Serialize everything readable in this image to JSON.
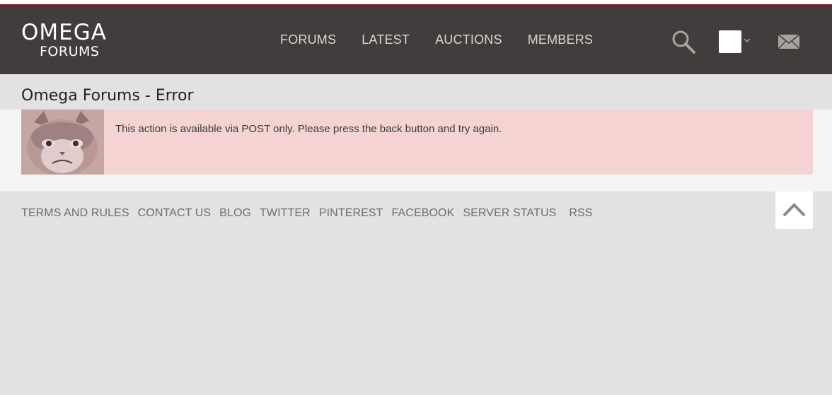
{
  "colors": {
    "header_bg": "#403d3c",
    "accent": "#7d1a22",
    "error_bg": "#f5d3d3",
    "page_bg": "#e2e2e2"
  },
  "header": {
    "logo": {
      "main": "OMEGA",
      "sub": "FORUMS"
    },
    "nav": [
      "FORUMS",
      "LATEST",
      "AUCTIONS",
      "MEMBERS"
    ],
    "icons": {
      "search": "search-icon",
      "account": "account-avatar",
      "dropdown": "chevron-down-icon",
      "messages": "envelope-icon"
    }
  },
  "page": {
    "title": "Omega Forums - Error"
  },
  "error": {
    "message": "This action is available via POST only. Please press the back button and try again."
  },
  "footer": {
    "links": [
      "TERMS AND RULES",
      "CONTACT US",
      "BLOG",
      "TWITTER",
      "PINTEREST",
      "FACEBOOK",
      "SERVER STATUS",
      "RSS"
    ]
  }
}
